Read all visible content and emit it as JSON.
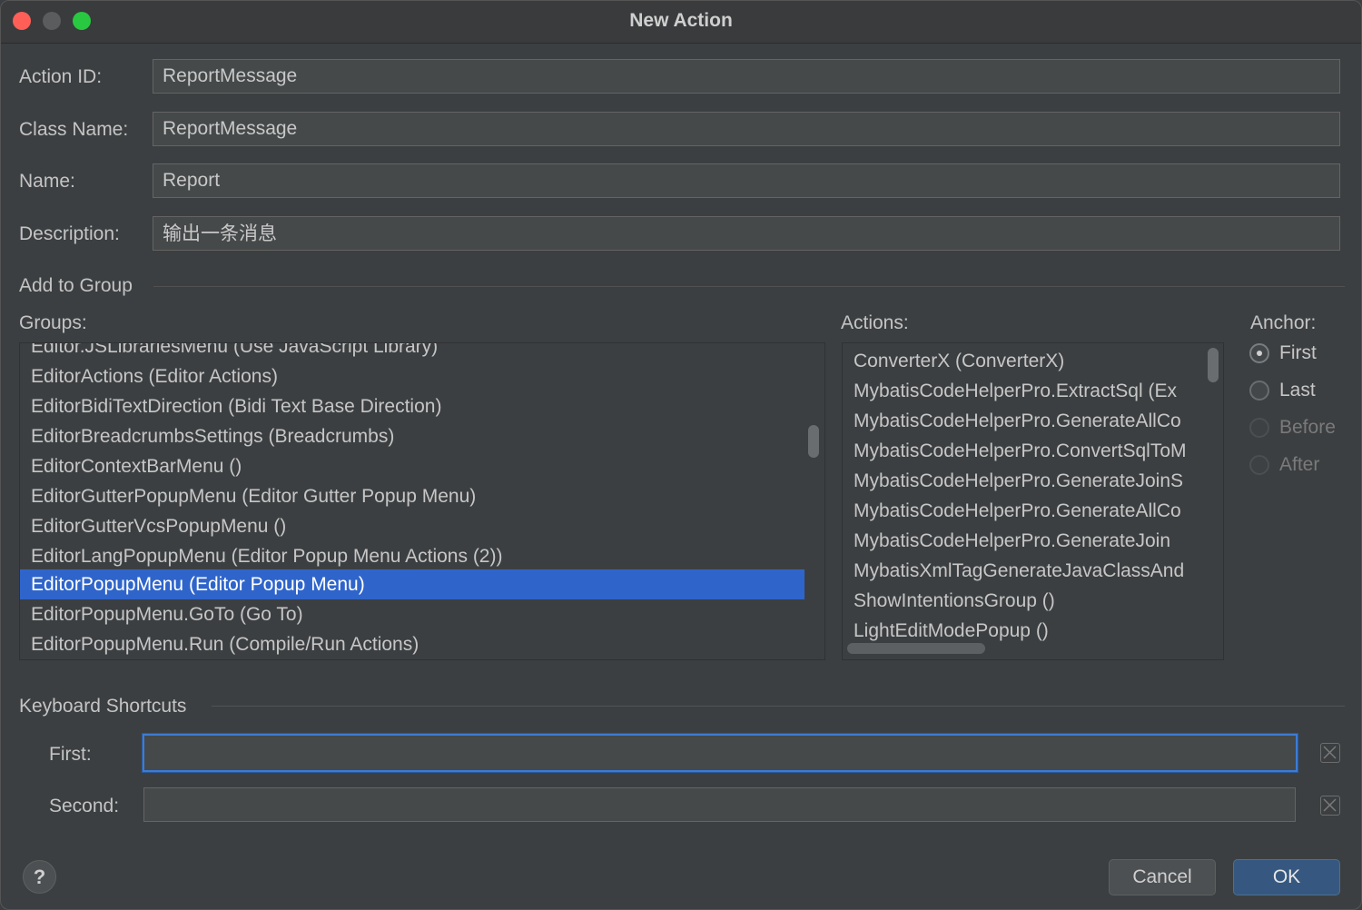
{
  "window": {
    "title": "New Action"
  },
  "form": {
    "action_id_label": "Action ID:",
    "action_id_value": "ReportMessage",
    "class_name_label": "Class Name:",
    "class_name_value": "ReportMessage",
    "name_label": "Name:",
    "name_value": "Report",
    "description_label": "Description:",
    "description_value": "输出一条消息"
  },
  "group_section": {
    "title": "Add to Group",
    "groups_label": "Groups:",
    "groups": [
      "Editor.JSLibrariesMenu (Use JavaScript Library)",
      "EditorActions (Editor Actions)",
      "EditorBidiTextDirection (Bidi Text Base Direction)",
      "EditorBreadcrumbsSettings (Breadcrumbs)",
      "EditorContextBarMenu ()",
      "EditorGutterPopupMenu (Editor Gutter Popup Menu)",
      "EditorGutterVcsPopupMenu ()",
      "EditorLangPopupMenu (Editor Popup Menu Actions (2))",
      "EditorPopupMenu (Editor Popup Menu)",
      "EditorPopupMenu.GoTo (Go To)",
      "EditorPopupMenu.Run (Compile/Run Actions)"
    ],
    "selected_group": "EditorPopupMenu (Editor Popup Menu)",
    "actions_label": "Actions:",
    "actions": [
      "ConverterX (ConverterX)",
      "MybatisCodeHelperPro.ExtractSql (Ex",
      "MybatisCodeHelperPro.GenerateAllCo",
      "MybatisCodeHelperPro.ConvertSqlToM",
      "MybatisCodeHelperPro.GenerateJoinS",
      "MybatisCodeHelperPro.GenerateAllCo",
      "MybatisCodeHelperPro.GenerateJoin",
      "MybatisXmlTagGenerateJavaClassAnd",
      "ShowIntentionsGroup ()",
      "LightEditModePopup ()"
    ],
    "anchor_label": "Anchor:",
    "anchor_options": [
      "First",
      "Last",
      "Before",
      "After"
    ],
    "anchor_selected": "First"
  },
  "shortcuts": {
    "title": "Keyboard Shortcuts",
    "first_label": "First:",
    "first_value": "",
    "second_label": "Second:",
    "second_value": ""
  },
  "buttons": {
    "help": "?",
    "cancel": "Cancel",
    "ok": "OK"
  },
  "colors": {
    "background": "#3c3f41",
    "selection": "#2f65ca",
    "ok_button": "#365880",
    "focus_border": "#3d7bd6"
  },
  "icons": {
    "help": "question-icon",
    "clear": "clear-x-icon"
  }
}
